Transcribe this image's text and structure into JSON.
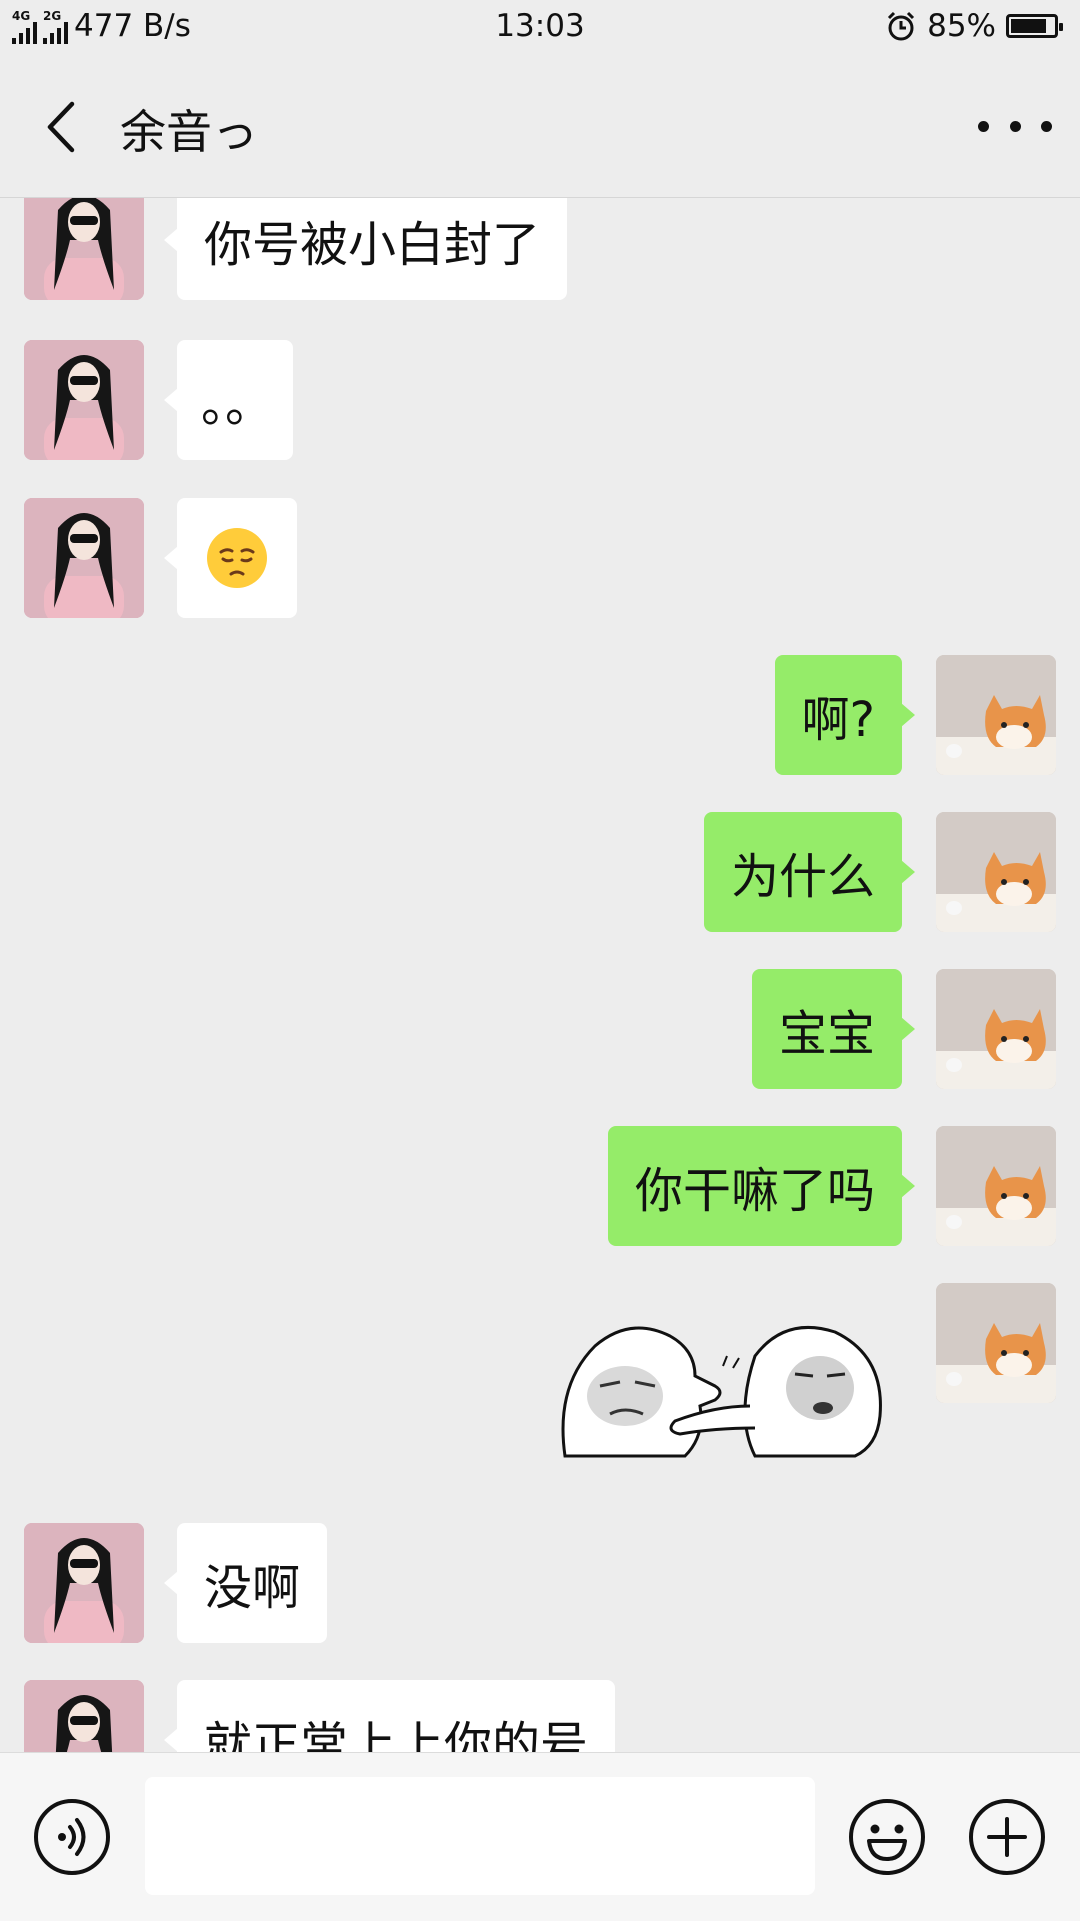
{
  "status": {
    "left_net": "4G",
    "right_net": "2G",
    "speed": "477 B/s",
    "time": "13:03",
    "battery": "85%",
    "battery_level": 0.85
  },
  "nav": {
    "title": "余音っ"
  },
  "messages": {
    "m1": "你号被小白封了",
    "m2": "。。",
    "m4": "啊?",
    "m5": "为什么",
    "m6": "宝宝",
    "m7": "你干嘛了吗",
    "m9": "没啊",
    "m10": "就正常上上你的号"
  },
  "input": {
    "value": ""
  },
  "colors": {
    "background": "#ededed",
    "incoming": "#ffffff",
    "outgoing": "#95ec69"
  }
}
